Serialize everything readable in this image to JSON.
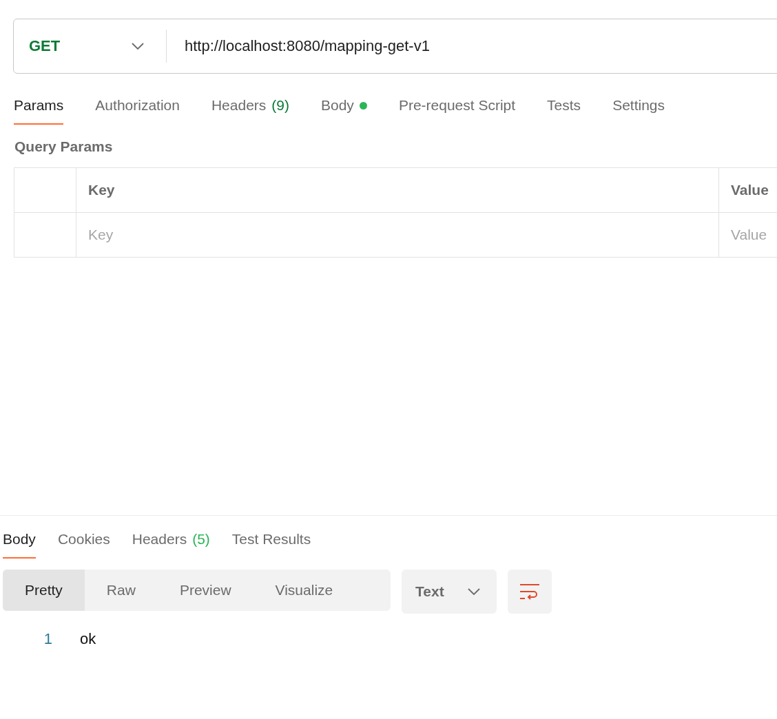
{
  "request": {
    "method": "GET",
    "url": "http://localhost:8080/mapping-get-v1"
  },
  "request_tabs": [
    {
      "label": "Params",
      "dot": false,
      "selected": true
    },
    {
      "label": "Authorization",
      "dot": false,
      "selected": false
    },
    {
      "label": "Headers",
      "count": "(9)",
      "dot": false,
      "selected": false
    },
    {
      "label": "Body",
      "dot": true,
      "selected": false
    },
    {
      "label": "Pre-request Script",
      "dot": false,
      "selected": false
    },
    {
      "label": "Tests",
      "dot": false,
      "selected": false
    },
    {
      "label": "Settings",
      "dot": false,
      "selected": false
    }
  ],
  "query_params": {
    "title": "Query Params",
    "columns": [
      "Key",
      "Value"
    ],
    "placeholders": [
      "Key",
      "Value"
    ]
  },
  "response_tabs": [
    {
      "label": "Body",
      "selected": true
    },
    {
      "label": "Cookies",
      "selected": false
    },
    {
      "label": "Headers",
      "count": "(5)",
      "selected": false
    },
    {
      "label": "Test Results",
      "selected": false
    }
  ],
  "view_modes": [
    {
      "label": "Pretty",
      "selected": true
    },
    {
      "label": "Raw",
      "selected": false
    },
    {
      "label": "Preview",
      "selected": false
    },
    {
      "label": "Visualize",
      "selected": false
    }
  ],
  "format": "Text",
  "lines": [
    {
      "number": "1",
      "text": "ok"
    }
  ]
}
